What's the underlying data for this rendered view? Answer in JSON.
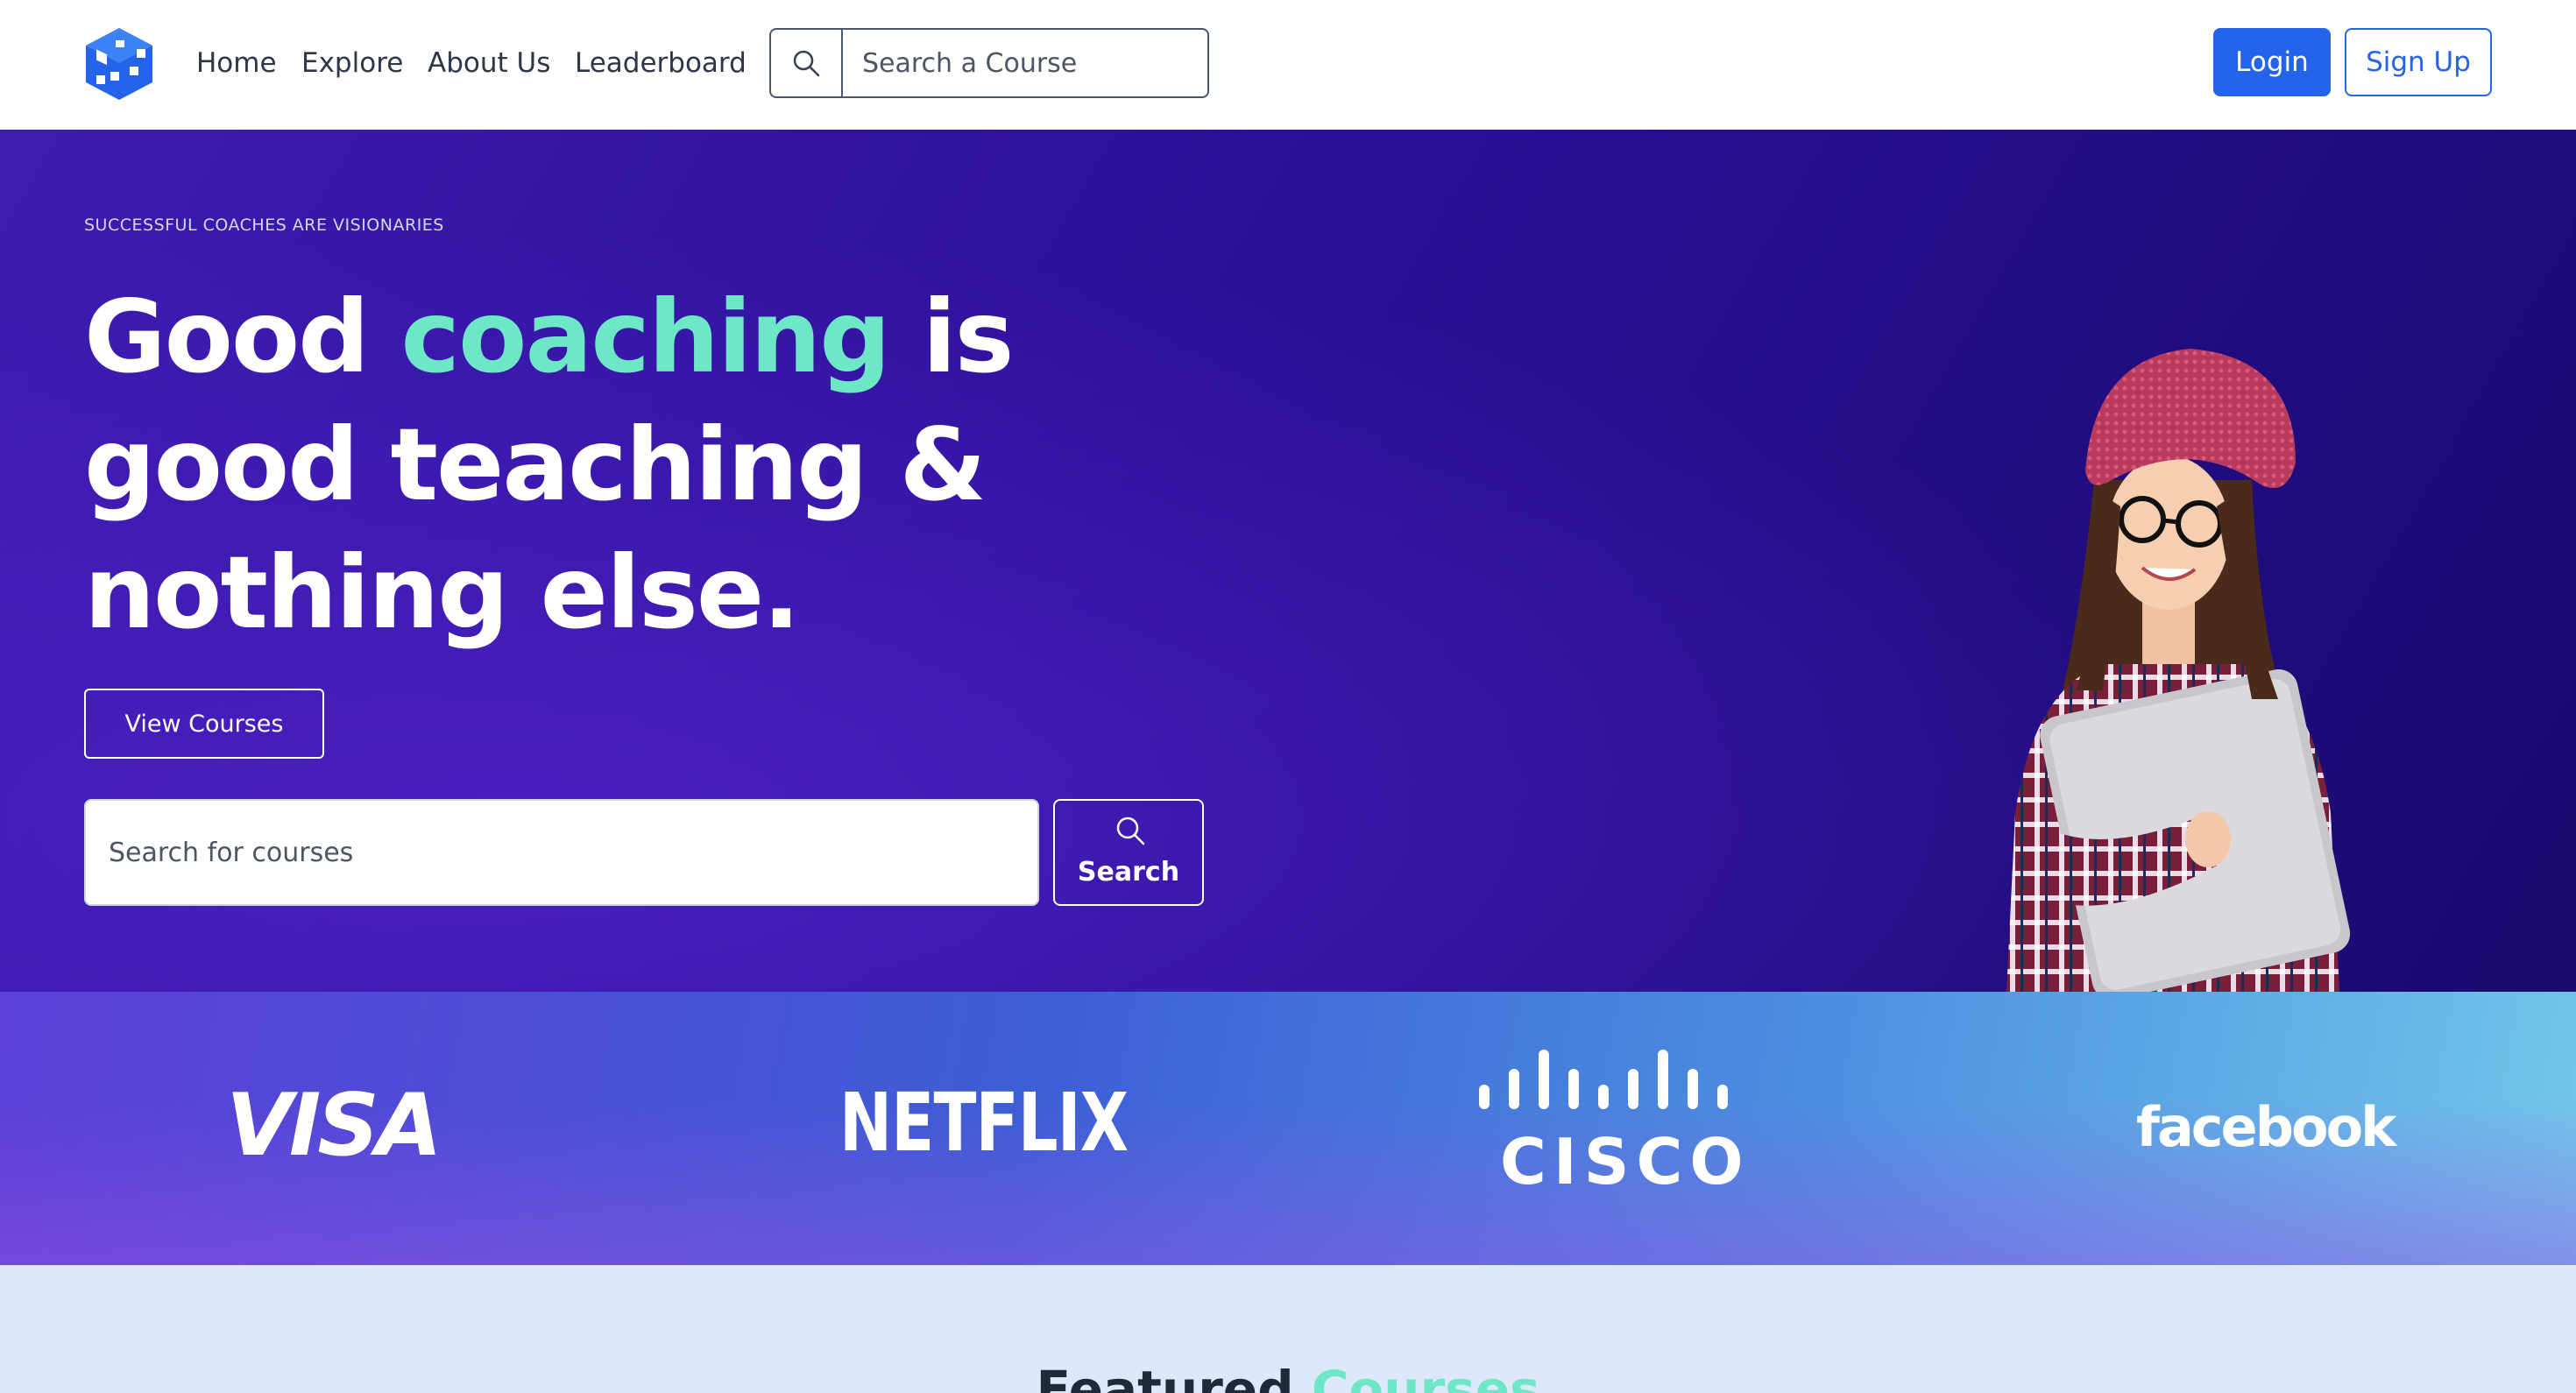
{
  "nav": {
    "links": [
      "Home",
      "Explore",
      "About Us",
      "Leaderboard"
    ],
    "search_placeholder": "Search a Course",
    "login_label": "Login",
    "signup_label": "Sign Up"
  },
  "hero": {
    "eyebrow": "SUCCESSFUL COACHES ARE VISIONARIES",
    "headline_part1": "Good ",
    "headline_accent": "coaching",
    "headline_part2": " is good teaching & nothing else.",
    "view_courses_label": "View Courses",
    "search_placeholder": "Search for courses",
    "search_button_label": "Search"
  },
  "partners": [
    "VISA",
    "NETFLIX",
    "CISCO",
    "facebook"
  ],
  "featured": {
    "title_part1": "Featured ",
    "title_accent": "Courses"
  },
  "colors": {
    "primary": "#2563eb",
    "accent": "#6ee7c7",
    "hero_bg": "#2a0f96",
    "featured_bg": "#dde8fa"
  },
  "icons": [
    "cube-logo-icon",
    "search-icon",
    "search-icon"
  ]
}
